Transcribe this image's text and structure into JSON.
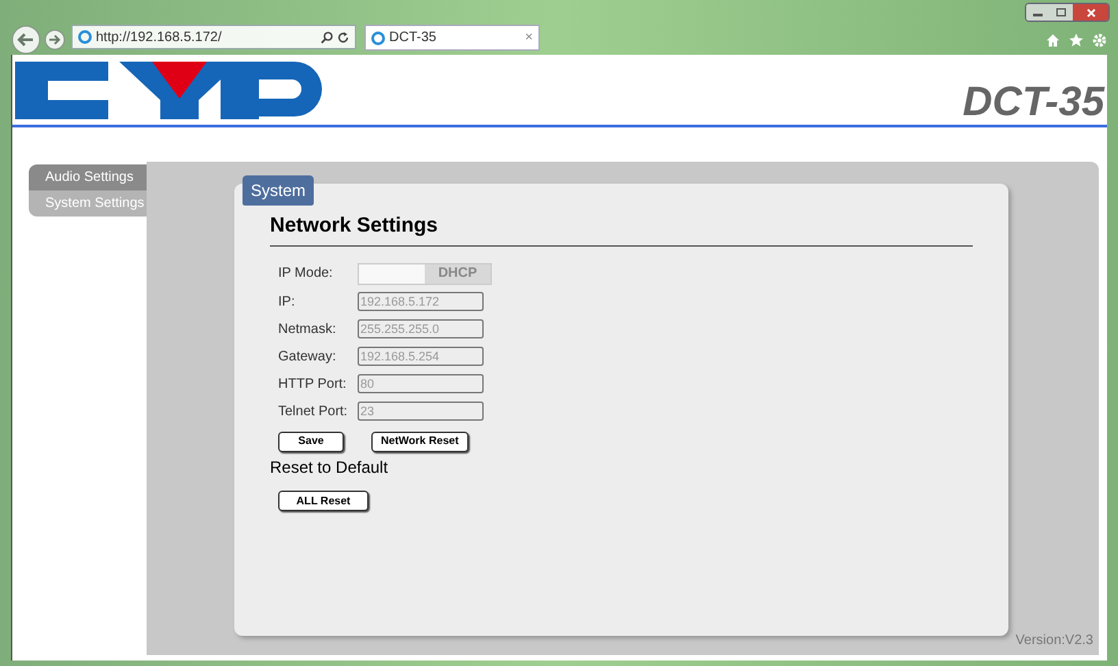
{
  "browser": {
    "address": "http://192.168.5.172/",
    "tab": {
      "title": "DCT-35",
      "close": "×"
    }
  },
  "header": {
    "product": "DCT-35"
  },
  "sidebar": {
    "items": [
      {
        "label": "Audio Settings",
        "selected": false
      },
      {
        "label": "System Settings",
        "selected": true
      }
    ]
  },
  "panel": {
    "tab": "System",
    "heading": "Network Settings",
    "ip_mode": {
      "label": "IP Mode:",
      "option": "DHCP",
      "on": true
    },
    "fields": [
      {
        "label": "IP:",
        "value": "192.168.5.172"
      },
      {
        "label": "Netmask:",
        "value": "255.255.255.0"
      },
      {
        "label": "Gateway:",
        "value": "192.168.5.254"
      },
      {
        "label": "HTTP Port:",
        "value": "80"
      },
      {
        "label": "Telnet Port:",
        "value": "23"
      }
    ],
    "buttons": [
      "Save",
      "NetWork Reset"
    ],
    "reset_heading": "Reset to Default",
    "reset_button": "ALL Reset"
  },
  "version": "Version:V2.3"
}
